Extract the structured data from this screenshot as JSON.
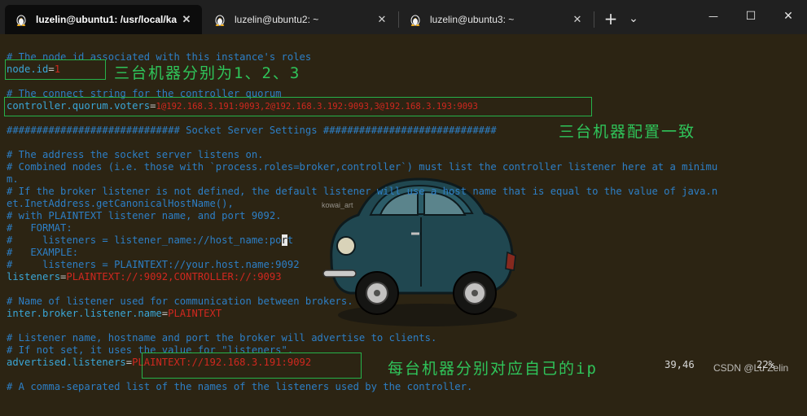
{
  "tabs": [
    {
      "title": "luzelin@ubuntu1: /usr/local/ka",
      "active": true,
      "icon": "linux-penguin-icon"
    },
    {
      "title": "luzelin@ubuntu2: ~",
      "active": false,
      "icon": "linux-penguin-icon"
    },
    {
      "title": "luzelin@ubuntu3: ~",
      "active": false,
      "icon": "linux-penguin-icon"
    }
  ],
  "tab_close_glyph": "✕",
  "new_tab_glyph": "+",
  "dropdown_glyph": "⌄",
  "window_controls": {
    "minimize": "—",
    "maximize": "☐",
    "close": "✕"
  },
  "terminal": {
    "comment_node_id": "# The node id associated with this instance's roles",
    "node_id_key": "node.id",
    "node_id_eq": "=",
    "node_id_val": "1",
    "comment_connect": "# The connect string for the controller quorum",
    "voters_key": "controller.quorum.voters",
    "voters_eq": "=",
    "voters_val": "1@192.168.3.191:9093,2@192.168.3.192:9093,3@192.168.3.193:9093",
    "socket_header": "############################# Socket Server Settings #############################",
    "comment_address": "# The address the socket server listens on.",
    "comment_combined_1": "# Combined nodes (i.e. those with `process.roles=broker,controller`) must list the controller listener here at a minimu",
    "comment_combined_2": "m.",
    "comment_broker_1": "# If the broker listener is not defined, the default listener will use a host name that is equal to the value of java.n",
    "comment_broker_2": "et.InetAddress.getCanonicalHostName(),",
    "comment_plaintext": "# with PLAINTEXT listener name, and port 9092.",
    "comment_format": "#   FORMAT:",
    "comment_format_example_pre": "#     listeners = listener_name://host_name:po",
    "comment_format_example_cursor": "r",
    "comment_format_example_post": "t",
    "comment_example": "#   EXAMPLE:",
    "comment_example_line": "#     listeners = PLAINTEXT://your.host.name:9092",
    "listeners_key": "listeners",
    "listeners_eq": "=",
    "listeners_val": "PLAINTEXT://:9092,CONTROLLER://:9093",
    "comment_listener_name": "# Name of listener used for communication between brokers.",
    "inter_key": "inter.broker.listener.name",
    "inter_eq": "=",
    "inter_val": "PLAINTEXT",
    "comment_advertise_1": "# Listener name, hostname and port the broker will advertise to clients.",
    "comment_advertise_2": "# If not set, it uses the value for \"listeners\".",
    "advertised_key": "advertised.listeners",
    "advertised_eq": "=",
    "advertised_val": "PLAINTEXT://192.168.3.191:9092",
    "comment_mapping": "# A comma-separated list of the names of the listeners used by the controller."
  },
  "annotations": {
    "node_id_note": "三台机器分别为1、2、3",
    "voters_note": "三台机器配置一致",
    "advertised_note": "每台机器分别对应自己的ip"
  },
  "car_label": "kowai_art",
  "status": {
    "cursor_position": "39,46",
    "scroll_percent": "22%"
  },
  "watermark": "CSDN @Lu Zelin",
  "colors": {
    "background": "#2c2413",
    "comment": "#2d7fc6",
    "value": "#d0281f",
    "annotation": "#2fc45a"
  }
}
